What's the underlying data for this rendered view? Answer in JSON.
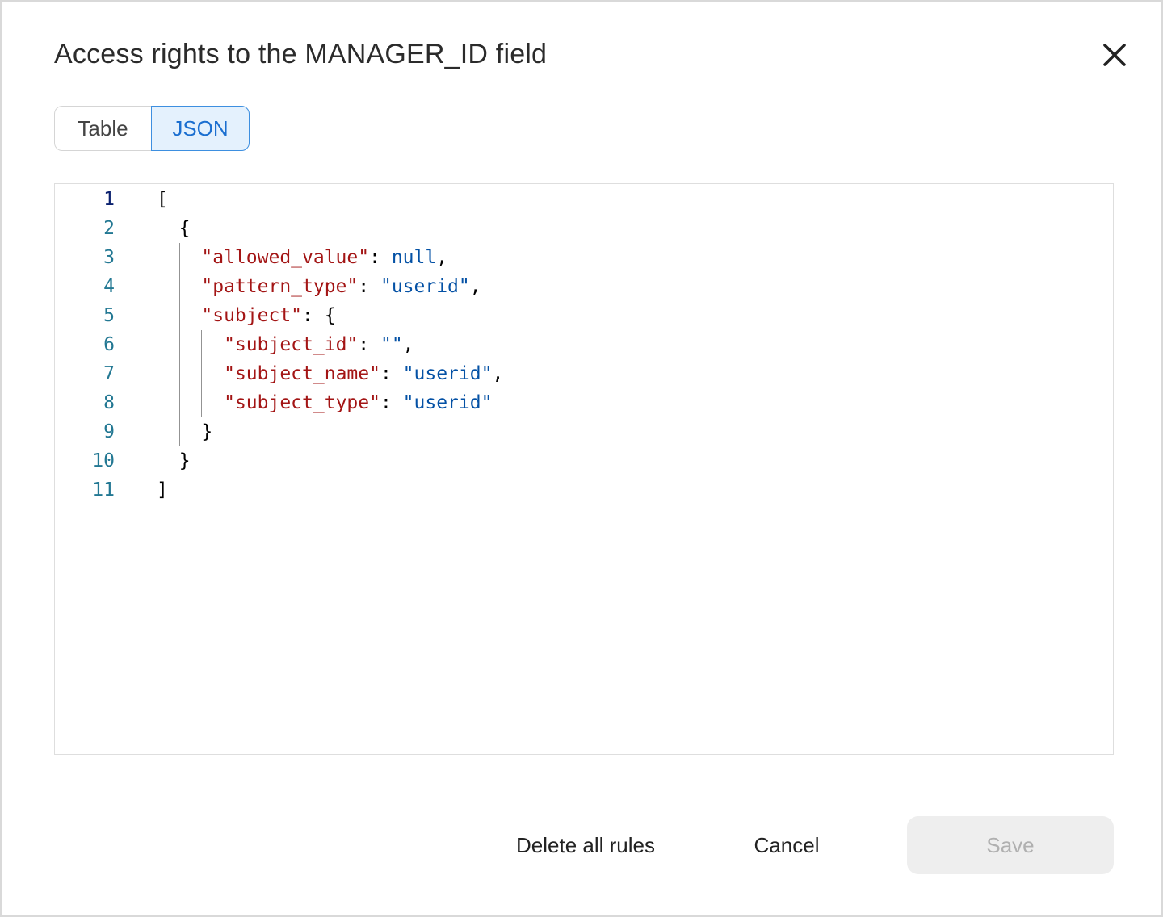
{
  "dialog": {
    "title": "Access rights to the MANAGER_ID field",
    "close_icon": "close-icon"
  },
  "view_toggle": {
    "options": [
      "Table",
      "JSON"
    ],
    "selected": "JSON"
  },
  "editor": {
    "line_numbers": [
      "1",
      "2",
      "3",
      "4",
      "5",
      "6",
      "7",
      "8",
      "9",
      "10",
      "11"
    ],
    "active_line": "1",
    "lines": [
      [
        {
          "t": "p",
          "v": "["
        }
      ],
      [
        {
          "t": "p",
          "v": "  {"
        }
      ],
      [
        {
          "t": "p",
          "v": "    "
        },
        {
          "t": "k",
          "v": "\"allowed_value\""
        },
        {
          "t": "p",
          "v": ": "
        },
        {
          "t": "n",
          "v": "null"
        },
        {
          "t": "p",
          "v": ","
        }
      ],
      [
        {
          "t": "p",
          "v": "    "
        },
        {
          "t": "k",
          "v": "\"pattern_type\""
        },
        {
          "t": "p",
          "v": ": "
        },
        {
          "t": "s",
          "v": "\"userid\""
        },
        {
          "t": "p",
          "v": ","
        }
      ],
      [
        {
          "t": "p",
          "v": "    "
        },
        {
          "t": "k",
          "v": "\"subject\""
        },
        {
          "t": "p",
          "v": ": {"
        }
      ],
      [
        {
          "t": "p",
          "v": "      "
        },
        {
          "t": "k",
          "v": "\"subject_id\""
        },
        {
          "t": "p",
          "v": ": "
        },
        {
          "t": "s",
          "v": "\"\""
        },
        {
          "t": "p",
          "v": ","
        }
      ],
      [
        {
          "t": "p",
          "v": "      "
        },
        {
          "t": "k",
          "v": "\"subject_name\""
        },
        {
          "t": "p",
          "v": ": "
        },
        {
          "t": "s",
          "v": "\"userid\""
        },
        {
          "t": "p",
          "v": ","
        }
      ],
      [
        {
          "t": "p",
          "v": "      "
        },
        {
          "t": "k",
          "v": "\"subject_type\""
        },
        {
          "t": "p",
          "v": ": "
        },
        {
          "t": "s",
          "v": "\"userid\""
        }
      ],
      [
        {
          "t": "p",
          "v": "    }"
        }
      ],
      [
        {
          "t": "p",
          "v": "  }"
        }
      ],
      [
        {
          "t": "p",
          "v": "]"
        }
      ]
    ],
    "colors": {
      "key": "#a31515",
      "string": "#0451a5",
      "literal": "#0451a5",
      "line_number": "#237893",
      "active_line_number": "#0b216f"
    }
  },
  "footer": {
    "delete_label": "Delete all rules",
    "cancel_label": "Cancel",
    "save_label": "Save",
    "save_enabled": false
  }
}
